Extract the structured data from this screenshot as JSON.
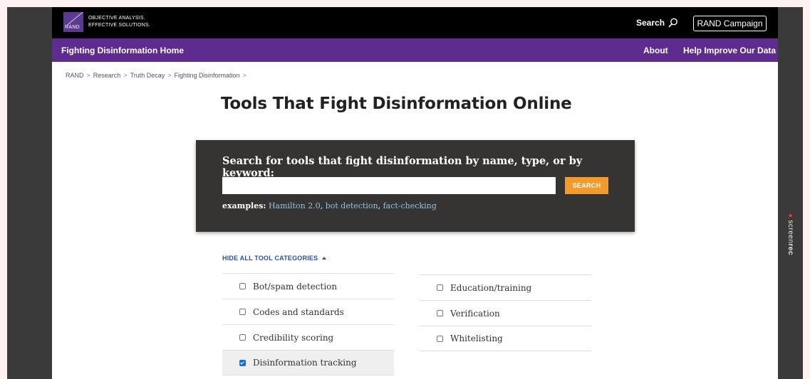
{
  "overlay": {
    "screenrec_prefix": "screen",
    "screenrec_suffix": "rec"
  },
  "header": {
    "logo_text": "RAND",
    "tagline_line1": "OBJECTIVE ANALYSIS.",
    "tagline_line2": "EFFECTIVE SOLUTIONS.",
    "search_label": "Search",
    "campaign_button": "RAND Campaign"
  },
  "subnav": {
    "home": "Fighting Disinformation Home",
    "about": "About",
    "help": "Help Improve Our Data"
  },
  "breadcrumb": {
    "items": [
      "RAND",
      "Research",
      "Truth Decay",
      "Fighting Disinformation"
    ],
    "separator": ">"
  },
  "page_title": "Tools That Fight Disinformation Online",
  "search": {
    "heading": "Search for tools that fight disinformation by name, type, or by keyword:",
    "input_value": "",
    "button_label": "SEARCH",
    "examples_label": "examples:",
    "examples": [
      "Hamilton 2.0",
      "bot detection",
      "fact-checking"
    ]
  },
  "categories": {
    "toggle_label": "HIDE ALL TOOL CATEGORIES",
    "left": [
      {
        "label": "Bot/spam detection",
        "checked": false
      },
      {
        "label": "Codes and standards",
        "checked": false
      },
      {
        "label": "Credibility scoring",
        "checked": false
      },
      {
        "label": "Disinformation tracking",
        "checked": true
      }
    ],
    "right": [
      {
        "label": "Education/training",
        "checked": false
      },
      {
        "label": "Verification",
        "checked": false
      },
      {
        "label": "Whitelisting",
        "checked": false
      }
    ]
  },
  "colors": {
    "topbar": "#000000",
    "subnav": "#5e2c8f",
    "panel": "#353433",
    "search_button": "#f39a2c",
    "link": "#2d4f9a",
    "example_link": "#8fc3d8",
    "checkbox_checked": "#1a6ed8"
  }
}
